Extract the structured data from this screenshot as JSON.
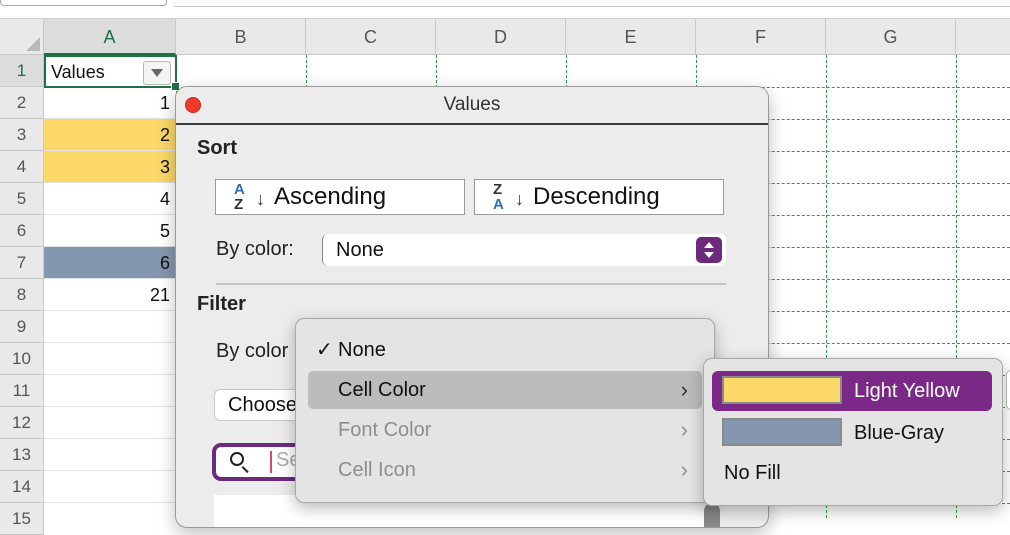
{
  "sheet": {
    "columns": [
      "A",
      "B",
      "C",
      "D",
      "E",
      "F",
      "G"
    ],
    "rows": [
      "1",
      "2",
      "3",
      "4",
      "5",
      "6",
      "7",
      "8",
      "9",
      "10",
      "11",
      "12",
      "13",
      "14",
      "15"
    ],
    "header_cell": "Values",
    "values": [
      "1",
      "2",
      "3",
      "4",
      "5",
      "6",
      "21"
    ],
    "colors": {
      "light_yellow": "#fcd869",
      "blue_gray": "#8497b0",
      "grid_green": "#2f9e4a",
      "accent": "#6d2a7d"
    }
  },
  "dialog": {
    "title": "Values",
    "sort_heading": "Sort",
    "ascending_label": "Ascending",
    "descending_label": "Descending",
    "by_color_label": "By color:",
    "sort_by_color_value": "None",
    "filter_heading": "Filter",
    "filter_by_color_label": "By color",
    "choose_label": "Choose",
    "search_placeholder": "Se"
  },
  "menu": {
    "items": [
      {
        "label": "None",
        "checked": "✓"
      },
      {
        "label": "Cell Color",
        "chevron": "›"
      },
      {
        "label": "Font Color",
        "chevron": "›"
      },
      {
        "label": "Cell Icon",
        "chevron": "›"
      }
    ]
  },
  "submenu": {
    "items": [
      {
        "label": "Light Yellow",
        "color": "#fcd869"
      },
      {
        "label": "Blue-Gray",
        "color": "#8497b0"
      },
      {
        "label": "No Fill"
      }
    ]
  }
}
